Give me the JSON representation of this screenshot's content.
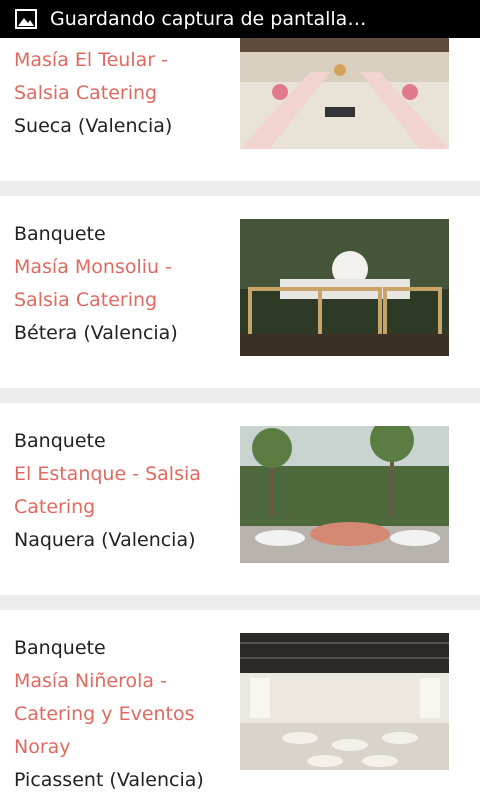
{
  "status_bar": {
    "notification_text": "Guardando captura de pantalla…",
    "icon": "image-icon"
  },
  "listings": [
    {
      "type": "",
      "name": "Masía El Teular - Salsia Catering",
      "location": "Sueca (Valencia)",
      "image": "banquet-hall-photo"
    },
    {
      "type": "Banquete",
      "name": "Masía Monsoliu - Salsia Catering",
      "location": "Bétera (Valencia)",
      "image": "garden-banquet-photo"
    },
    {
      "type": "Banquete",
      "name": "El Estanque - Salsia Catering",
      "location": "Naquera (Valencia)",
      "image": "outdoor-palm-banquet-photo"
    },
    {
      "type": "Banquete",
      "name": "Masía Niñerola - Catering y Eventos Noray",
      "location": "Picassent (Valencia)",
      "image": "indoor-hall-photo"
    }
  ]
}
